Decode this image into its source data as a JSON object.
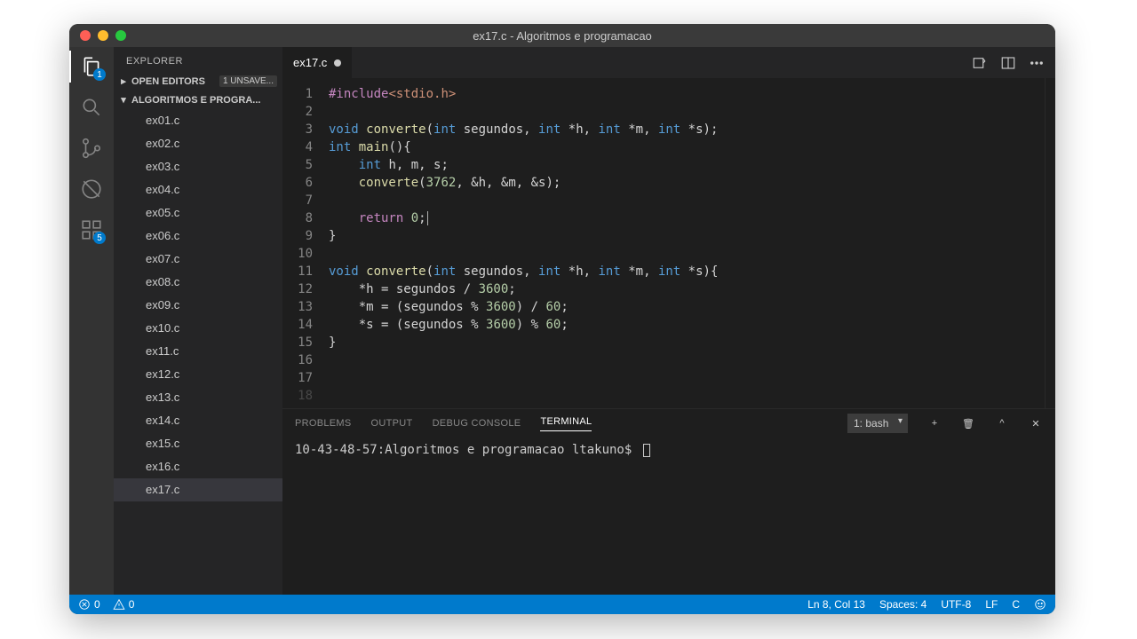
{
  "window": {
    "title": "ex17.c - Algoritmos e programacao"
  },
  "activity": {
    "explorer_badge": "1",
    "debug_badge": "5"
  },
  "sidebar": {
    "title": "EXPLORER",
    "open_editors_label": "OPEN EDITORS",
    "unsaved_label": "1 UNSAVE...",
    "project_label": "ALGORITMOS E PROGRA...",
    "files": [
      "ex01.c",
      "ex02.c",
      "ex03.c",
      "ex04.c",
      "ex05.c",
      "ex06.c",
      "ex07.c",
      "ex08.c",
      "ex09.c",
      "ex10.c",
      "ex11.c",
      "ex12.c",
      "ex13.c",
      "ex14.c",
      "ex15.c",
      "ex16.c",
      "ex17.c"
    ],
    "selected": "ex17.c"
  },
  "tab": {
    "label": "ex17.c",
    "dirty": true
  },
  "code_lines": [
    [
      [
        "pre",
        "#include"
      ],
      [
        "inc",
        "<stdio.h>"
      ]
    ],
    [],
    [
      [
        "kw",
        "void"
      ],
      [
        "txt",
        " "
      ],
      [
        "fn",
        "converte"
      ],
      [
        "txt",
        "("
      ],
      [
        "type",
        "int"
      ],
      [
        "txt",
        " segundos, "
      ],
      [
        "type",
        "int"
      ],
      [
        "txt",
        " *h, "
      ],
      [
        "type",
        "int"
      ],
      [
        "txt",
        " *m, "
      ],
      [
        "type",
        "int"
      ],
      [
        "txt",
        " *s);"
      ]
    ],
    [
      [
        "type",
        "int"
      ],
      [
        "txt",
        " "
      ],
      [
        "fn",
        "main"
      ],
      [
        "txt",
        "(){"
      ]
    ],
    [
      [
        "txt",
        "    "
      ],
      [
        "type",
        "int"
      ],
      [
        "txt",
        " h, m, s;"
      ]
    ],
    [
      [
        "txt",
        "    "
      ],
      [
        "fn",
        "converte"
      ],
      [
        "txt",
        "("
      ],
      [
        "num",
        "3762"
      ],
      [
        "txt",
        ", &h, &m, &s);"
      ]
    ],
    [],
    [
      [
        "txt",
        "    "
      ],
      [
        "ret",
        "return"
      ],
      [
        "txt",
        " "
      ],
      [
        "num",
        "0"
      ],
      [
        "txt",
        ";"
      ],
      [
        "cursor",
        ""
      ]
    ],
    [
      [
        "txt",
        "}"
      ]
    ],
    [],
    [
      [
        "kw",
        "void"
      ],
      [
        "txt",
        " "
      ],
      [
        "fn",
        "converte"
      ],
      [
        "txt",
        "("
      ],
      [
        "type",
        "int"
      ],
      [
        "txt",
        " segundos, "
      ],
      [
        "type",
        "int"
      ],
      [
        "txt",
        " *h, "
      ],
      [
        "type",
        "int"
      ],
      [
        "txt",
        " *m, "
      ],
      [
        "type",
        "int"
      ],
      [
        "txt",
        " *s){"
      ]
    ],
    [
      [
        "txt",
        "    *h = segundos / "
      ],
      [
        "num",
        "3600"
      ],
      [
        "txt",
        ";"
      ]
    ],
    [
      [
        "txt",
        "    *m = (segundos % "
      ],
      [
        "num",
        "3600"
      ],
      [
        "txt",
        ") / "
      ],
      [
        "num",
        "60"
      ],
      [
        "txt",
        ";"
      ]
    ],
    [
      [
        "txt",
        "    *s = (segundos % "
      ],
      [
        "num",
        "3600"
      ],
      [
        "txt",
        ") % "
      ],
      [
        "num",
        "60"
      ],
      [
        "txt",
        ";"
      ]
    ],
    [
      [
        "txt",
        "}"
      ]
    ],
    [],
    []
  ],
  "panel": {
    "tabs": [
      "PROBLEMS",
      "OUTPUT",
      "DEBUG CONSOLE",
      "TERMINAL"
    ],
    "active": "TERMINAL",
    "terminal_select": "1: bash",
    "prompt": "10-43-48-57:Algoritmos e programacao ltakuno$"
  },
  "status": {
    "errors": "0",
    "warnings": "0",
    "ln_col": "Ln 8, Col 13",
    "spaces": "Spaces: 4",
    "encoding": "UTF-8",
    "eol": "LF",
    "lang": "C"
  }
}
